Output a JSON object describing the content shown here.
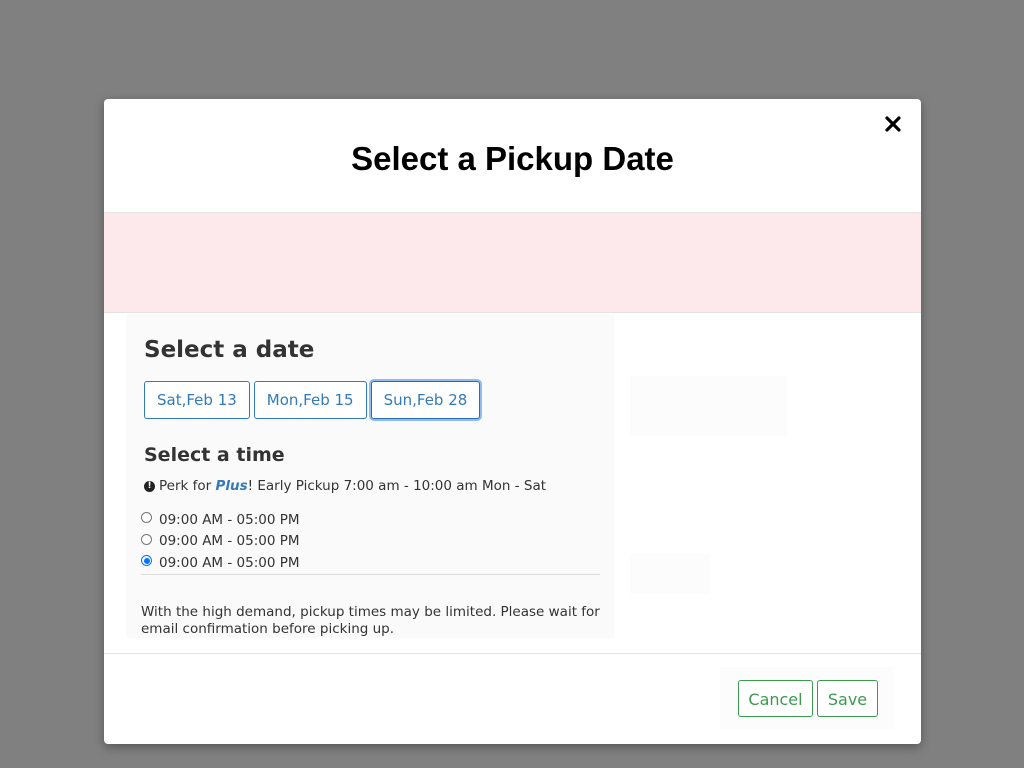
{
  "modal": {
    "title": "Select a Pickup Date",
    "close_icon": "close-icon"
  },
  "date_section": {
    "heading": "Select a date",
    "dates": [
      {
        "label": "Sat,Feb 13",
        "selected": false
      },
      {
        "label": "Mon,Feb 15",
        "selected": false
      },
      {
        "label": "Sun,Feb 28",
        "selected": true
      }
    ]
  },
  "time_section": {
    "heading": "Select a time",
    "perk": {
      "prefix": "Perk for ",
      "plus": "Plus",
      "suffix": "! Early Pickup 7:00 am - 10:00 am Mon - Sat",
      "icon": "info-icon"
    },
    "options": [
      {
        "label": "09:00 AM - 05:00 PM",
        "checked": false
      },
      {
        "label": "09:00 AM - 05:00 PM",
        "checked": false
      },
      {
        "label": "09:00 AM - 05:00 PM",
        "checked": true
      }
    ]
  },
  "notice": "With the high demand, pickup times may be limited. Please wait for email confirmation before picking up.",
  "footer": {
    "cancel_label": "Cancel",
    "save_label": "Save"
  },
  "colors": {
    "overlay": "#808080",
    "alert_band": "#fde8ec",
    "date_accent": "#337ab7",
    "footer_accent": "#3c9a4f",
    "radio_checked": "#0075ff"
  }
}
